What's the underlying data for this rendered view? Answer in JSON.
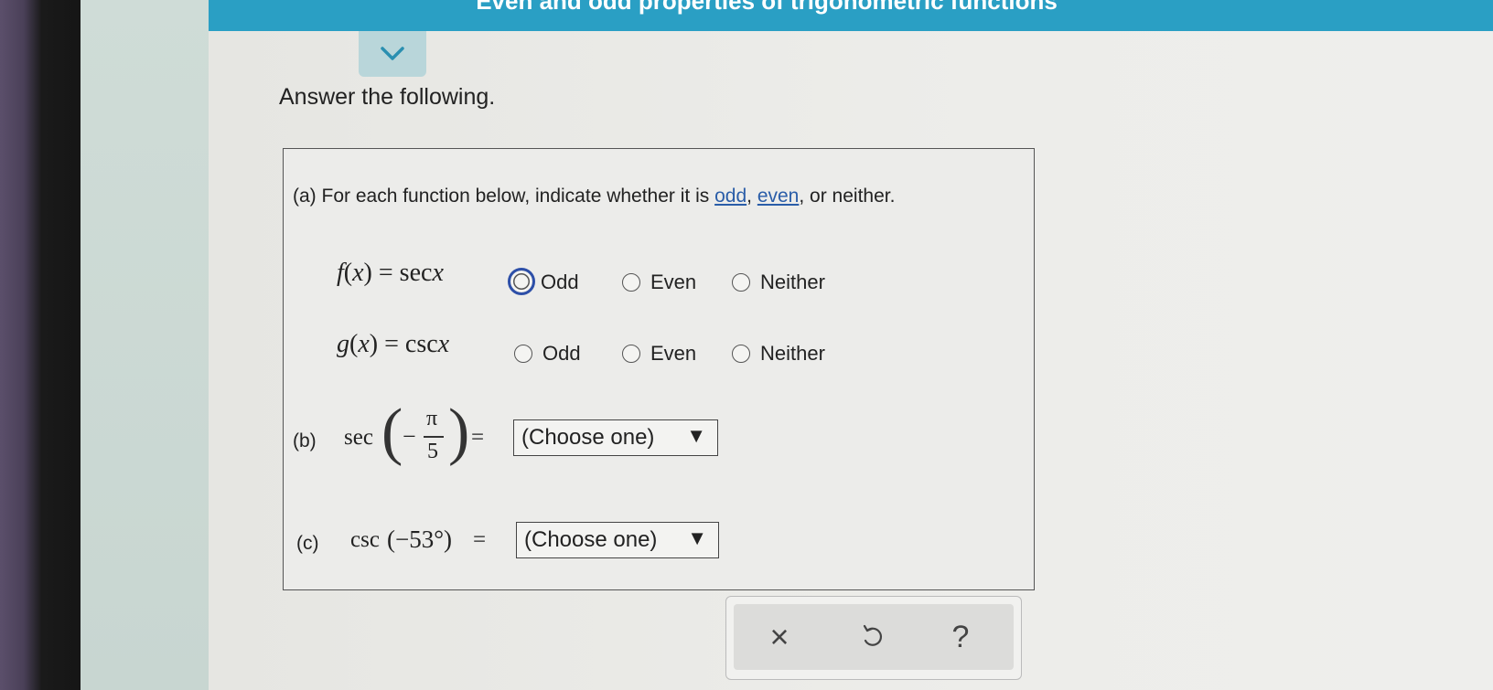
{
  "banner": {
    "title": "Even and odd properties of trigonometric functions"
  },
  "prompt": "Answer the following.",
  "part_a": {
    "label": "(a)",
    "text_pre": "For each function below, indicate whether it is",
    "link_odd": "odd",
    "comma": ",",
    "link_even": "even",
    "text_post": ", or neither.",
    "rows": [
      {
        "fn": "f",
        "var": "x",
        "rhs": "sec",
        "rhs_var": "x",
        "selected": "Odd"
      },
      {
        "fn": "g",
        "var": "x",
        "rhs": "csc",
        "rhs_var": "x",
        "selected": null
      }
    ],
    "options": [
      "Odd",
      "Even",
      "Neither"
    ]
  },
  "part_b": {
    "label": "(b)",
    "func": "sec",
    "minus": "−",
    "numerator": "π",
    "denominator": "5",
    "equals": "=",
    "select_value": "(Choose one)",
    "arrow": "▼"
  },
  "part_c": {
    "label": "(c)",
    "func": "csc",
    "arg": "(−53°)",
    "equals": "=",
    "select_value": "(Choose one)",
    "arrow": "▼"
  },
  "actions": {
    "clear": "×",
    "undo_icon": "undo-icon",
    "help": "?"
  },
  "colors": {
    "banner": "#2a9fc4",
    "link": "#2a5da8",
    "radio_selected": "#2d4fa8"
  }
}
